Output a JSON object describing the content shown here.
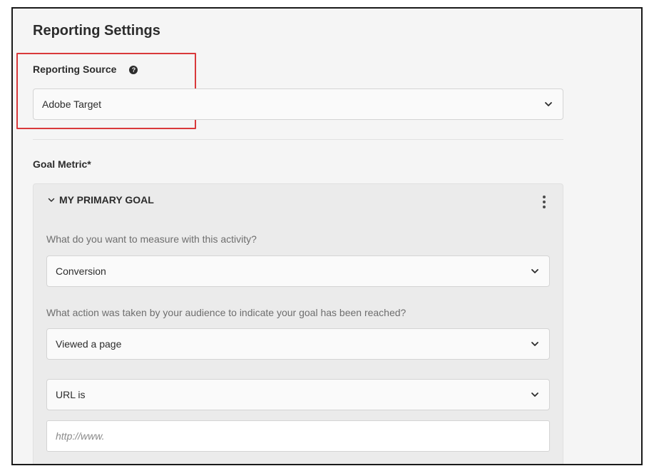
{
  "page": {
    "title": "Reporting Settings"
  },
  "reporting_source": {
    "label": "Reporting Source",
    "help_icon": "question-circle-icon",
    "value": "Adobe Target",
    "highlight_color": "#d9393b"
  },
  "goal_metric": {
    "label": "Goal Metric*",
    "card": {
      "title": "MY PRIMARY GOAL",
      "collapse_icon": "chevron-down-icon",
      "menu_icon": "more-vertical-icon",
      "question_1": "What do you want to measure with this activity?",
      "measure_value": "Conversion",
      "question_2": "What action was taken by your audience to indicate your goal has been reached?",
      "action_value": "Viewed a page",
      "url_condition_value": "URL is",
      "url_placeholder": "http://www."
    }
  }
}
